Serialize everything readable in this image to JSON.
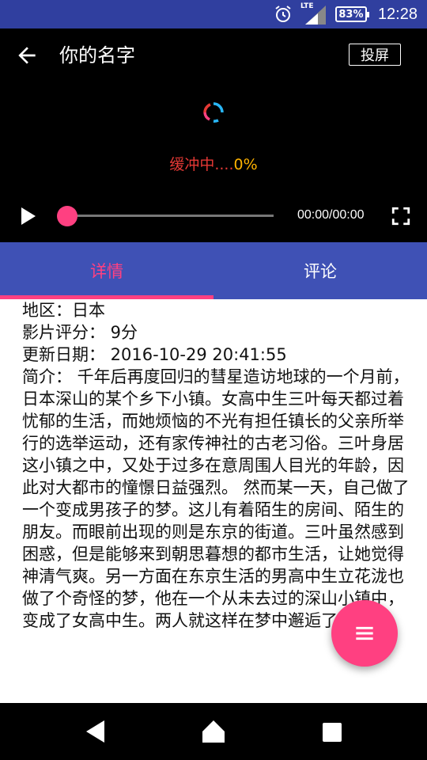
{
  "status_bar": {
    "battery": "83%",
    "time": "12:28",
    "network": "LTE"
  },
  "player": {
    "title": "你的名字",
    "cast_label": "投屏",
    "buffer_label": "缓冲中....",
    "buffer_percent": "0%",
    "time_readout": "00:00/00:00",
    "progress": 0
  },
  "tabs": [
    {
      "label": "详情",
      "active": true
    },
    {
      "label": "评论",
      "active": false
    }
  ],
  "details": {
    "region": "地区：日本",
    "rating": "影片评分：  9分",
    "updated": "更新日期：  2016-10-29 20:41:55",
    "summary": "简介：  千年后再度回归的彗星造访地球的一个月前，日本深山的某个乡下小镇。女高中生三叶每天都过着忧郁的生活，而她烦恼的不光有担任镇长的父亲所举行的选举运动，还有家传神社的古老习俗。三叶身居这小镇之中，又处于过多在意周围人目光的年龄，因此对大都市的憧憬日益强烈。 然而某一天，自己做了一个变成男孩子的梦。这儿有着陌生的房间、陌生的朋友。而眼前出现的则是东京的街道。三叶虽然感到困惑，但是能够来到朝思暮想的都市生活，让她觉得神清气爽。另一方面在东京生活的男高中生立花泷也做了个奇怪的梦，他在一个从未去过的深山小镇中，变成了女高中生。两人就这样在梦中邂逅了彼此。"
  },
  "colors": {
    "status_bar": "#303f9f",
    "tab_bar": "#3f51b5",
    "accent": "#ff4081",
    "buffer_label": "#e53935",
    "buffer_percent": "#ffb300"
  },
  "icons": {
    "alarm": "alarm-icon",
    "signal": "signal-icon",
    "battery": "battery-icon",
    "back": "arrow-back-icon",
    "spinner": "loading-spinner-icon",
    "play": "play-icon",
    "fullscreen": "fullscreen-icon",
    "fab": "menu-icon",
    "nav_back": "nav-back-icon",
    "nav_home": "nav-home-icon",
    "nav_recent": "nav-recent-icon"
  }
}
